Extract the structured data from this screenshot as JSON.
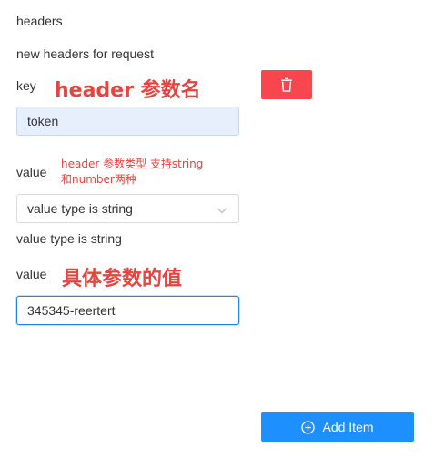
{
  "section": {
    "title": "headers",
    "description": "new headers for request"
  },
  "key_field": {
    "label": "key",
    "annotation": "header 参数名",
    "value": "token"
  },
  "delete_button": {
    "icon": "trash-icon",
    "color": "#f7464e"
  },
  "type_field": {
    "label": "value",
    "annotation_line1": "header 参数类型 支持string",
    "annotation_line2": "和number两种",
    "selected": "value type is string",
    "help": "value type is string"
  },
  "value_field": {
    "label": "value",
    "annotation": "具体参数的值",
    "value": "345345-reertert"
  },
  "add_button": {
    "label": "Add Item",
    "icon": "plus-circle-icon",
    "color": "#1e8fff"
  },
  "annotation_color": "#e8433e"
}
